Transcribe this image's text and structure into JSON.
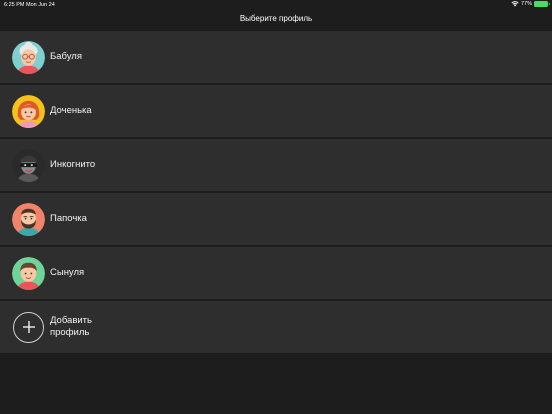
{
  "status_bar": {
    "time_date": "6:25 PM   Mon Jun 24",
    "battery_percent": "77%",
    "battery_level": 77
  },
  "header": {
    "title": "Выберите профиль"
  },
  "profiles": [
    {
      "name": "Бабуля",
      "avatar": "grandma-avatar-icon",
      "bg": "#7ecfd0"
    },
    {
      "name": "Доченька",
      "avatar": "daughter-avatar-icon",
      "bg": "#f5c21a"
    },
    {
      "name": "Инкогнито",
      "avatar": "incognito-avatar-icon",
      "bg": "#2a2a2a"
    },
    {
      "name": "Папочка",
      "avatar": "dad-avatar-icon",
      "bg": "#f0836a"
    },
    {
      "name": "Сынуля",
      "avatar": "son-avatar-icon",
      "bg": "#6fd49a"
    }
  ],
  "add_profile": {
    "label": "Добавить профиль",
    "icon": "plus-icon"
  },
  "colors": {
    "background": "#1d1d1d",
    "row": "#2e2e2e",
    "battery": "#4cd964"
  }
}
